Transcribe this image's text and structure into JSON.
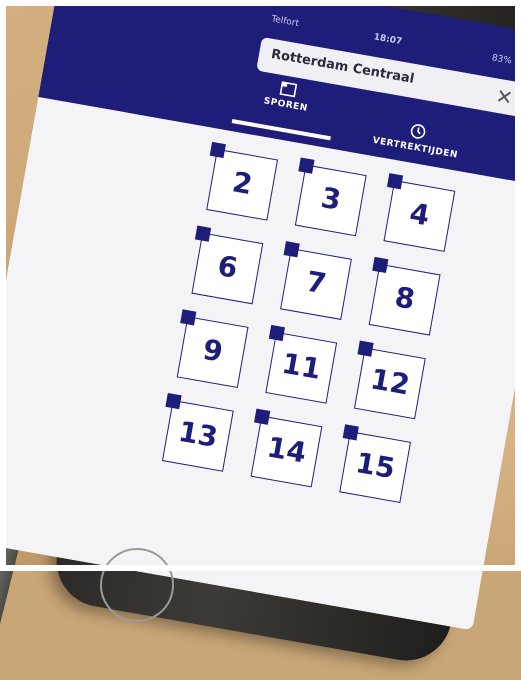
{
  "search": {
    "value": "Rotterdam Centraal"
  },
  "status": {
    "carrier": "Telfort",
    "time": "18:07",
    "battery": "83%"
  },
  "tabs": [
    {
      "label": "SPOREN",
      "active": true
    },
    {
      "label": "VERTREKTIJDEN",
      "active": false
    }
  ],
  "tracks": [
    "2",
    "3",
    "4",
    "6",
    "7",
    "8",
    "9",
    "11",
    "12",
    "13",
    "14",
    "15"
  ],
  "colors": {
    "brand_blue": "#1f1d7a",
    "background": "#f4f4f6"
  }
}
